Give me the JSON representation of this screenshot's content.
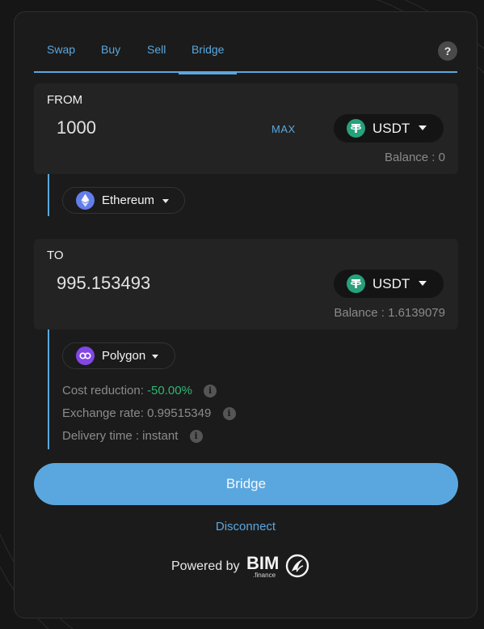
{
  "tabs": [
    {
      "label": "Swap"
    },
    {
      "label": "Buy"
    },
    {
      "label": "Sell"
    },
    {
      "label": "Bridge",
      "active": true
    }
  ],
  "help_label": "?",
  "from": {
    "label": "FROM",
    "amount": "1000",
    "max_label": "MAX",
    "token": "USDT",
    "token_icon": "tether-icon",
    "balance": "Balance : 0",
    "network": "Ethereum",
    "network_icon": "ethereum-icon"
  },
  "to": {
    "label": "TO",
    "amount": "995.153493",
    "token": "USDT",
    "token_icon": "tether-icon",
    "balance": "Balance : 1.6139079",
    "network": "Polygon",
    "network_icon": "polygon-icon"
  },
  "details": {
    "cost_reduction_label": "Cost reduction:",
    "cost_reduction_value": "-50.00%",
    "exchange_rate": "Exchange rate: 0.99515349",
    "delivery_time": "Delivery time : instant"
  },
  "bridge_button": "Bridge",
  "disconnect": "Disconnect",
  "powered_by": "Powered by",
  "brand": {
    "name": "BIM",
    "suffix": ".finance"
  },
  "colors": {
    "accent": "#5aa7df",
    "positive": "#2fb573",
    "tether": "#26a17b",
    "ethereum": "#627eea",
    "polygon": "#8247e5"
  }
}
